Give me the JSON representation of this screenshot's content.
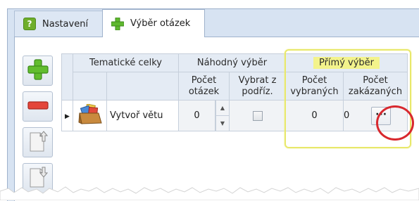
{
  "tabs": [
    {
      "label": "Nastavení",
      "active": false,
      "icon": "question-icon"
    },
    {
      "label": "Výběr otázek",
      "active": true,
      "icon": "green-plus-icon"
    }
  ],
  "toolbar": [
    {
      "name": "add-button",
      "icon": "green-plus-icon"
    },
    {
      "name": "remove-button",
      "icon": "red-minus-icon"
    },
    {
      "name": "move-up-button",
      "icon": "page-up-icon"
    },
    {
      "name": "move-down-button",
      "icon": "page-down-icon"
    }
  ],
  "grid": {
    "group_headers": {
      "topics": "Tematické celky",
      "random": "Náhodný výběr",
      "direct": "Přímý výběr"
    },
    "sub_headers": {
      "question_count": [
        "Počet",
        "otázek"
      ],
      "select_from_sub": [
        "Vybrat z",
        "podříz."
      ],
      "selected_count": [
        "Počet",
        "vybraných"
      ],
      "forbidden_count": [
        "Počet",
        "zakázaných"
      ]
    },
    "rows": [
      {
        "topic": "Vytvoř větu",
        "question_count": "0",
        "select_from_sub": false,
        "selected_count": "0",
        "forbidden_count": "0",
        "ellipsis": "···"
      }
    ]
  },
  "colors": {
    "highlight_box": "#e8e86a",
    "callout_circle": "#d8282e",
    "accent_green": "#6fae2c"
  }
}
